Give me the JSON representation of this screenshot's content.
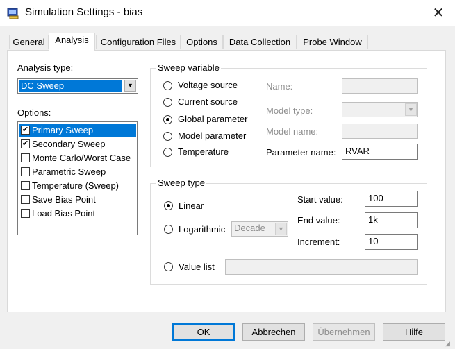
{
  "window": {
    "title": "Simulation Settings - bias",
    "icon": "pspice-app-icon"
  },
  "tabs": [
    {
      "label": "General"
    },
    {
      "label": "Analysis"
    },
    {
      "label": "Configuration Files"
    },
    {
      "label": "Options"
    },
    {
      "label": "Data Collection"
    },
    {
      "label": "Probe Window"
    }
  ],
  "analysis_type": {
    "label": "Analysis type:",
    "value": "DC Sweep"
  },
  "options": {
    "label": "Options:",
    "items": [
      {
        "label": "Primary Sweep",
        "checked": true,
        "selected": true
      },
      {
        "label": "Secondary Sweep",
        "checked": true,
        "selected": false
      },
      {
        "label": "Monte Carlo/Worst Case",
        "checked": false,
        "selected": false
      },
      {
        "label": "Parametric Sweep",
        "checked": false,
        "selected": false
      },
      {
        "label": "Temperature (Sweep)",
        "checked": false,
        "selected": false
      },
      {
        "label": "Save Bias Point",
        "checked": false,
        "selected": false
      },
      {
        "label": "Load Bias Point",
        "checked": false,
        "selected": false
      }
    ]
  },
  "sweep_variable": {
    "title": "Sweep variable",
    "radios": [
      {
        "label": "Voltage source",
        "selected": false
      },
      {
        "label": "Current source",
        "selected": false
      },
      {
        "label": "Global parameter",
        "selected": true
      },
      {
        "label": "Model parameter",
        "selected": false
      },
      {
        "label": "Temperature",
        "selected": false
      }
    ],
    "name_label": "Name:",
    "name_value": "",
    "model_type_label": "Model type:",
    "model_type_value": "",
    "model_name_label": "Model name:",
    "model_name_value": "",
    "param_name_label": "Parameter name:",
    "param_name_value": "RVAR"
  },
  "sweep_type": {
    "title": "Sweep type",
    "linear_label": "Linear",
    "log_label": "Logarithmic",
    "log_scale_value": "Decade",
    "value_list_label": "Value list",
    "value_list_value": "",
    "selected": "linear",
    "start_label": "Start value:",
    "start_value": "100",
    "end_label": "End value:",
    "end_value": "1k",
    "increment_label": "Increment:",
    "increment_value": "10"
  },
  "buttons": {
    "ok": "OK",
    "cancel": "Abbrechen",
    "apply": "Übernehmen",
    "help": "Hilfe"
  },
  "colors": {
    "accent": "#0078d7",
    "window_bg": "#f0f0f0",
    "disabled_text": "#8d8d8d"
  }
}
